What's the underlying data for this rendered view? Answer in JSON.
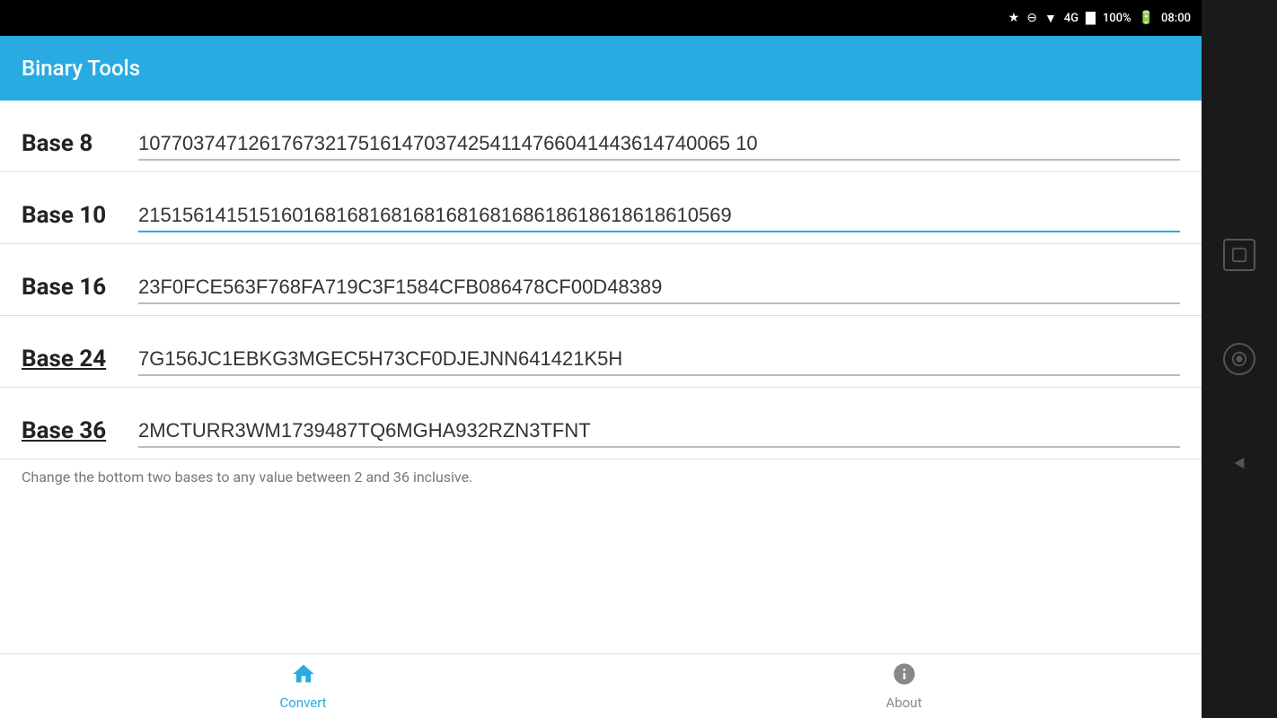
{
  "statusBar": {
    "bluetooth": "⚡",
    "signal": "▼",
    "wifi": "▲",
    "network": "4G",
    "battery_pct": "100%",
    "time": "08:00"
  },
  "appBar": {
    "title": "Binary Tools"
  },
  "rows": [
    {
      "label": "Base 8",
      "value": "107703747126176732175161470374254114766041443614740065 10",
      "active": false,
      "underlined": false
    },
    {
      "label": "Base 10",
      "value": "2151561415151601681681681681681681686186186186186105 69",
      "active": true,
      "underlined": false
    },
    {
      "label": "Base 16",
      "value": "23F0FCE563F768FA719C3F1584CFB086478CF00D48389",
      "active": false,
      "underlined": false
    },
    {
      "label": "Base 24",
      "value": "7G156JC1EBKG3MGEC5H73CF0DJEJNN641421K5H",
      "active": false,
      "underlined": true
    },
    {
      "label": "Base 36",
      "value": "2MCTURR3WM1739487TQ6MGHA932RZN3TFNT",
      "active": false,
      "underlined": true
    }
  ],
  "hintText": "Change the bottom two bases to any value between 2 and 36 inclusive.",
  "bottomNav": [
    {
      "icon": "🏠",
      "label": "Convert",
      "active": true
    },
    {
      "icon": "ℹ",
      "label": "About",
      "active": false
    }
  ],
  "sideBar": {
    "squareBtn": "▭",
    "circleBtn": "◉",
    "backBtn": "◀"
  }
}
